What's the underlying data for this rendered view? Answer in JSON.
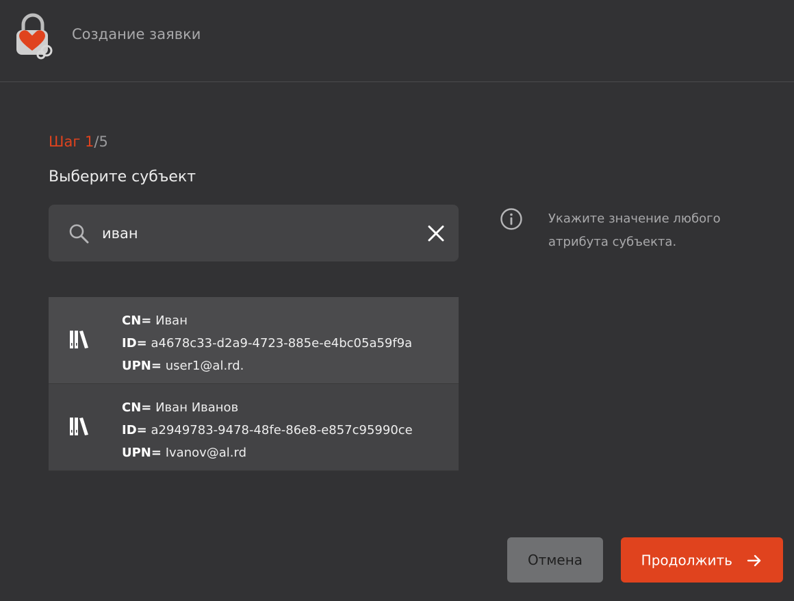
{
  "header": {
    "title": "Создание заявки",
    "logo_icon": "lock-heart-logo"
  },
  "step": {
    "prefix": "Шаг",
    "current": "1",
    "separator": "/",
    "total": "5"
  },
  "section": {
    "title": "Выберите субъект"
  },
  "search": {
    "value": "иван",
    "icon": "search-icon",
    "clear_icon": "close-icon"
  },
  "hint": {
    "icon": "info-icon",
    "text": "Укажите значение любого атрибута субъекта."
  },
  "results": [
    {
      "icon": "books-icon",
      "cn_label": "CN=",
      "cn": "Иван",
      "id_label": "ID=",
      "id": "a4678c33-d2a9-4723-885e-e4bc05a59f9a",
      "upn_label": "UPN=",
      "upn": "user1@al.rd."
    },
    {
      "icon": "books-icon",
      "cn_label": "CN=",
      "cn": "Иван Иванов",
      "id_label": "ID=",
      "id": "a2949783-9478-48fe-86e8-e857c95990ce",
      "upn_label": "UPN=",
      "upn": "Ivanov@al.rd"
    }
  ],
  "buttons": {
    "cancel": "Отмена",
    "continue": "Продолжить",
    "continue_icon": "arrow-right-icon"
  },
  "colors": {
    "background": "#323234",
    "panel": "#434345",
    "accent": "#e0431e",
    "cancel": "#6f7072"
  }
}
